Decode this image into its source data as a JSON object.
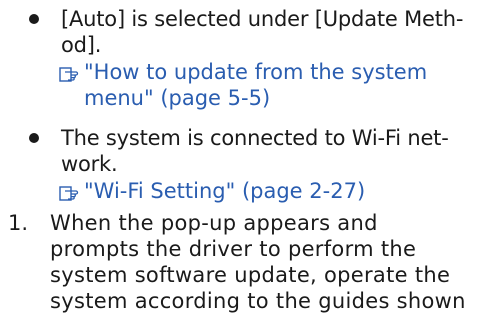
{
  "bullets": [
    {
      "lines": [
        "[Auto] is selected under [Update Meth-",
        "od]."
      ],
      "reference": {
        "icon": "pointing-hand-reference-icon",
        "lines": [
          "\"How to update from the system",
          "menu\" (page 5-5)"
        ]
      }
    },
    {
      "lines": [
        "The system is connected to Wi-Fi net-",
        "work."
      ],
      "reference": {
        "icon": "pointing-hand-reference-icon",
        "lines": [
          "\"Wi-Fi Setting\" (page 2-27)"
        ]
      }
    }
  ],
  "steps": [
    {
      "number": "1.",
      "lines": [
        "When the pop-up appears and",
        "prompts the driver to perform the",
        "system software update, operate the",
        "system according to the guides shown"
      ]
    }
  ],
  "colors": {
    "text": "#1a1a1a",
    "link": "#2a5db0"
  }
}
